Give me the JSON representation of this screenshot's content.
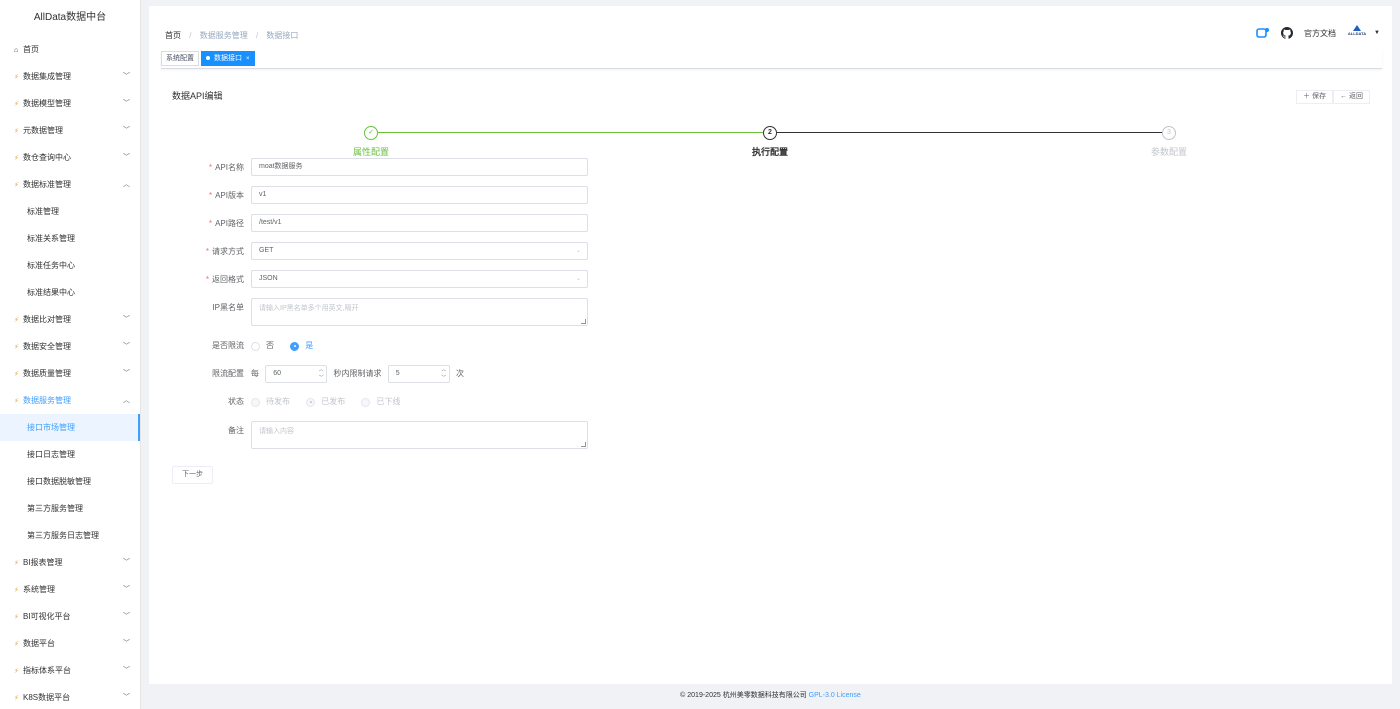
{
  "app_title": "AllData数据中台",
  "sidebar": {
    "items": [
      {
        "label": "首页",
        "expanded": null
      },
      {
        "label": "数据集成管理",
        "expanded": false
      },
      {
        "label": "数据模型管理",
        "expanded": false
      },
      {
        "label": "元数据管理",
        "expanded": false
      },
      {
        "label": "数仓查询中心",
        "expanded": false
      },
      {
        "label": "数据标准管理",
        "expanded": true,
        "children": [
          "标准管理",
          "标准关系管理",
          "标准任务中心",
          "标准结果中心"
        ]
      },
      {
        "label": "数据比对管理",
        "expanded": false
      },
      {
        "label": "数据安全管理",
        "expanded": false
      },
      {
        "label": "数据质量管理",
        "expanded": false
      },
      {
        "label": "数据服务管理",
        "expanded": true,
        "children": [
          "接口市场管理",
          "接口日志管理",
          "接口数据脱敏管理",
          "第三方服务管理",
          "第三方服务日志管理"
        ]
      },
      {
        "label": "BI报表管理",
        "expanded": false
      },
      {
        "label": "系统管理",
        "expanded": false
      },
      {
        "label": "BI可视化平台",
        "expanded": false
      },
      {
        "label": "数据平台",
        "expanded": false
      },
      {
        "label": "指标体系平台",
        "expanded": false
      },
      {
        "label": "K8S数据平台",
        "expanded": false
      }
    ],
    "active_child": "接口市场管理"
  },
  "breadcrumb": [
    "首页",
    "数据服务管理",
    "数据接口"
  ],
  "header_right": {
    "docs_label": "官方文档",
    "avatar_text": "ALLDATA"
  },
  "tags": [
    {
      "label": "系统配置",
      "active": false
    },
    {
      "label": "数据接口",
      "active": true
    }
  ],
  "card": {
    "title": "数据API编辑",
    "save_label": "保存",
    "back_label": "返回"
  },
  "steps": [
    {
      "index": "1",
      "label": "属性配置",
      "status": "done"
    },
    {
      "index": "2",
      "label": "执行配置",
      "status": "process"
    },
    {
      "index": "3",
      "label": "参数配置",
      "status": "wait"
    }
  ],
  "form": {
    "api_name": {
      "label": "API名称",
      "value": "moat数据服务"
    },
    "api_version": {
      "label": "API版本",
      "value": "v1"
    },
    "api_path": {
      "label": "API路径",
      "value": "/test/v1"
    },
    "req_method": {
      "label": "请求方式",
      "value": "GET"
    },
    "res_type": {
      "label": "返回格式",
      "value": "JSON"
    },
    "deny": {
      "label": "IP黑名单",
      "placeholder": "请输入IP黑名单多个用英文,隔开"
    },
    "rate_limit": {
      "label": "是否限流",
      "options": [
        "否",
        "是"
      ],
      "selected": "是"
    },
    "limit_config": {
      "label": "限流配置",
      "prefix": "每",
      "seconds": "60",
      "middle": "秒内限制请求",
      "times": "5",
      "suffix": "次"
    },
    "status": {
      "label": "状态",
      "options": [
        "待发布",
        "已发布",
        "已下线"
      ],
      "selected": "已发布"
    },
    "remark": {
      "label": "备注",
      "placeholder": "请输入内容"
    }
  },
  "next_label": "下一步",
  "footer": {
    "text": "© 2019-2025 杭州美零数据科技有限公司",
    "link": "GPL-3.0 License"
  },
  "colors": {
    "primary": "#409eff",
    "success": "#67c23a",
    "danger": "#f56c6c"
  }
}
